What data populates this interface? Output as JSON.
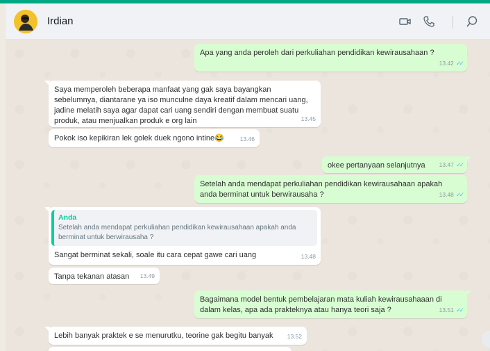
{
  "header": {
    "contact_name": "Irdian",
    "icons": [
      "video-call-icon",
      "voice-call-icon",
      "search-icon"
    ]
  },
  "colors": {
    "accent": "#00a884",
    "outgoing_bubble": "#d9fdd3",
    "incoming_bubble": "#ffffff",
    "read_tick": "#53bdeb"
  },
  "messages": [
    {
      "dir": "out",
      "text": "Apa yang anda peroleh dari perkuliahan pendidikan kewirausahaan ?",
      "time": "13.42",
      "read": true
    },
    {
      "dir": "in",
      "text": "Saya memperoleh beberapa manfaat yang gak saya bayangkan sebelumnya, diantarane ya iso munculne daya kreatif dalam mencari uang, jadine melatih saya agar dapat cari uang sendiri dengan membuat suatu produk, atau menjualkan produk e org lain",
      "time": "13.45"
    },
    {
      "dir": "in",
      "text": "Pokok iso kepikiran lek golek duek ngono intine😂",
      "time": "13.46"
    },
    {
      "dir": "out",
      "text": "okee pertanyaan selanjutnya",
      "time": "13.47",
      "read": true
    },
    {
      "dir": "out",
      "text": "Setelah anda mendapat perkuliahan pendidikan kewirausahaan apakah anda berminat untuk berwirausaha ?",
      "time": "13.48",
      "read": true
    },
    {
      "dir": "in",
      "quote_author": "Anda",
      "quote_text": "Setelah anda mendapat perkuliahan pendidikan kewirausahaan apakah anda berminat untuk berwirausaha ?",
      "text": "Sangat berminat  sekali, soale itu cara cepat gawe cari uang",
      "time": "13.48"
    },
    {
      "dir": "in",
      "text": "Tanpa tekanan atasan",
      "time": "13.49"
    },
    {
      "dir": "out",
      "text": "Bagaimana model bentuk pembelajaran mata kuliah kewirausahaaan di dalam kelas, apa ada prakteknya atau hanya teori saja ?",
      "time": "13.51",
      "read": true
    },
    {
      "dir": "in",
      "text": "Lebih banyak praktek e se menurutku, teorine gak begitu banyak",
      "time": "13.52"
    }
  ]
}
